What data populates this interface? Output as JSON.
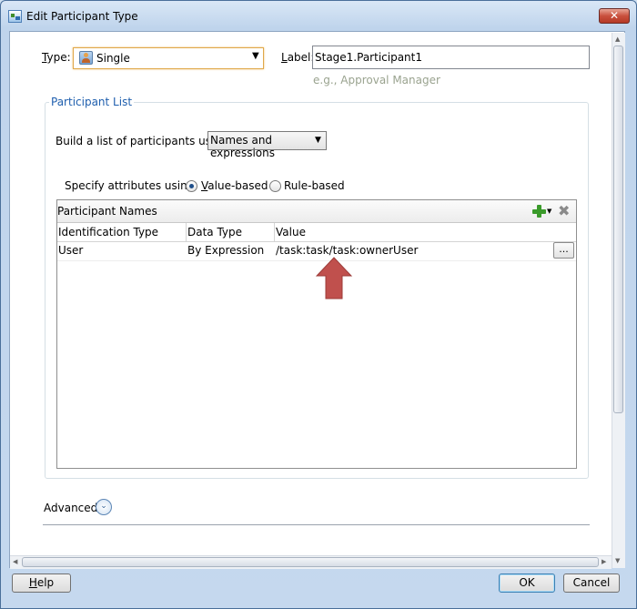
{
  "window": {
    "title": "Edit Participant Type",
    "close_label": "✕"
  },
  "type_field": {
    "label": "Type:",
    "label_mnemonic": "T",
    "label_rest": "ype:",
    "value": "Single",
    "icon": "person-icon"
  },
  "label_field": {
    "label_mnemonic": "L",
    "label_rest": "abel:",
    "value": "Stage1.Participant1",
    "hint": "e.g., Approval Manager"
  },
  "participant_list": {
    "title": "Participant List",
    "build_label": "Build a list of participants using:",
    "build_value": "Names and expressions",
    "specify_label": "Specify attributes using:",
    "radio_value_based_mnemonic": "V",
    "radio_value_based_rest": "alue-based",
    "radio_rule_based": "Rule-based",
    "selected_radio": "value-based"
  },
  "participant_names": {
    "title": "Participant Names",
    "columns": [
      "Identification Type",
      "Data Type",
      "Value"
    ],
    "rows": [
      {
        "identification_type": "User",
        "data_type": "By Expression",
        "value": "/task:task/task:ownerUser",
        "button": "..."
      }
    ]
  },
  "advanced": {
    "label": "Advanced:"
  },
  "footer": {
    "help_mnemonic": "H",
    "help_rest": "elp",
    "ok_label": "OK",
    "cancel_label": "Cancel"
  },
  "colors": {
    "annotation_arrow": "#c0504d",
    "group_title": "#1f5fae",
    "hint_text": "#9aa38f"
  }
}
